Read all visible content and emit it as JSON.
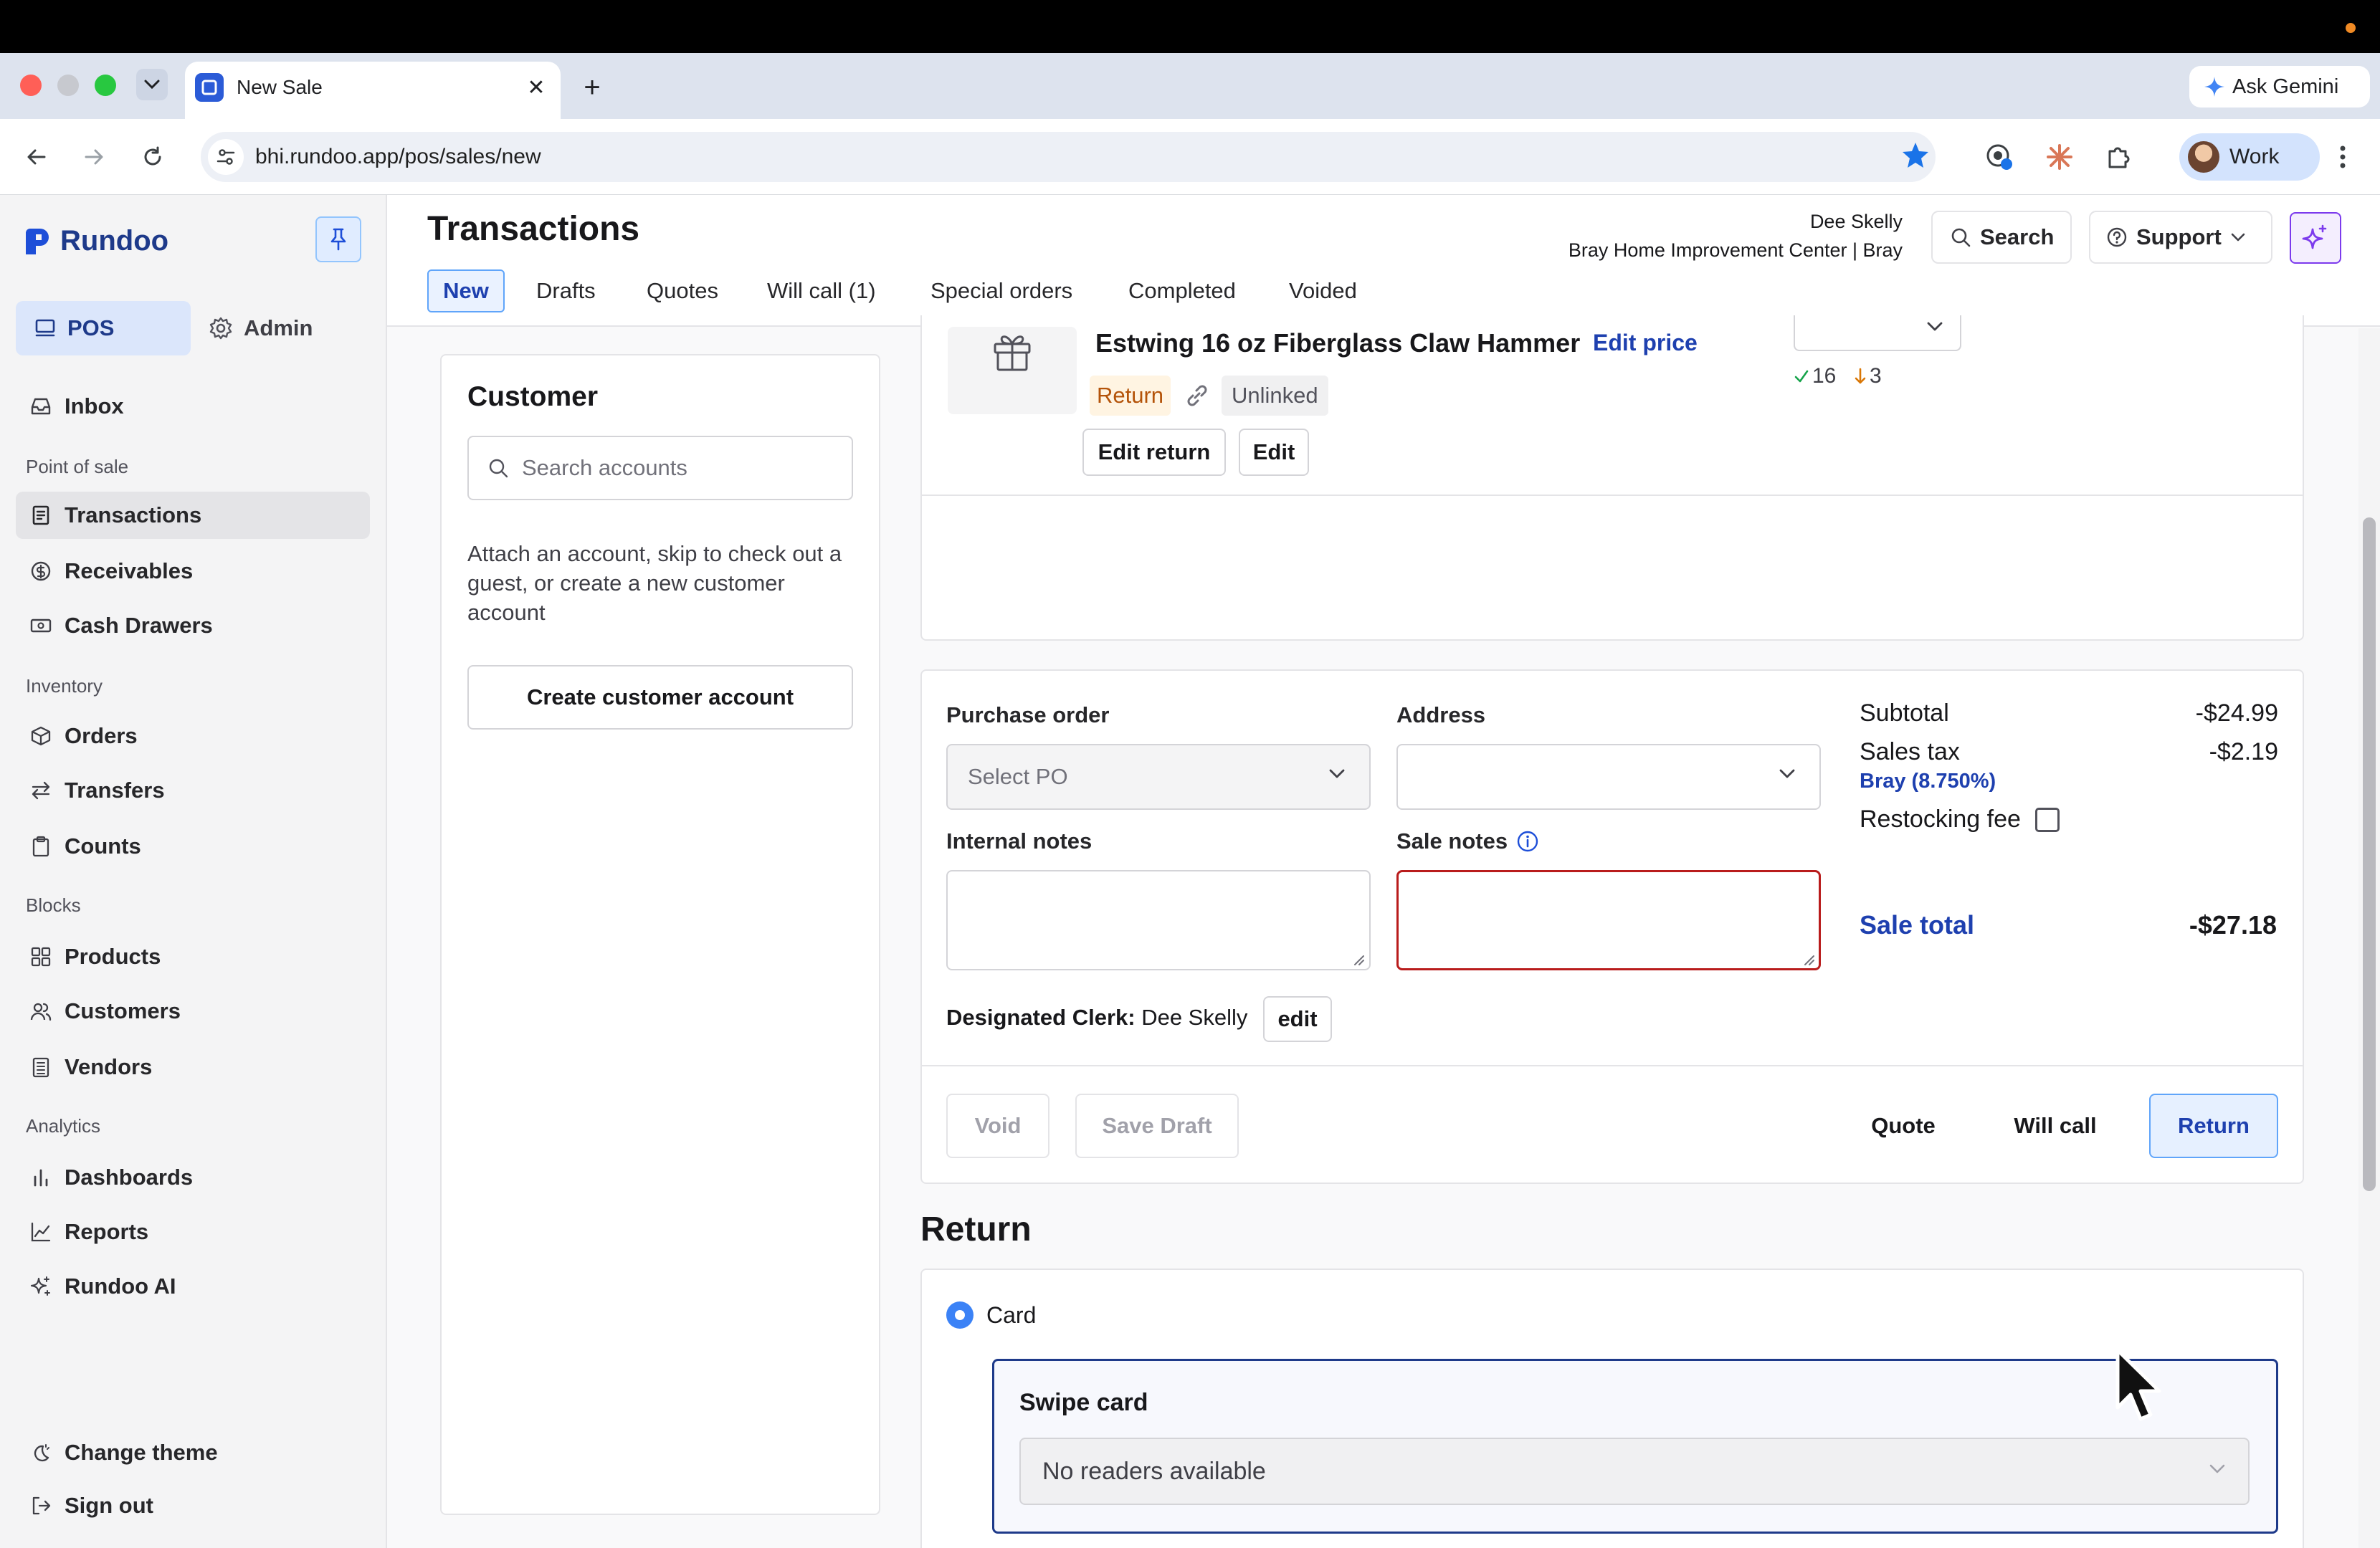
{
  "browser": {
    "tab_title": "New Sale",
    "url": "bhi.rundoo.app/pos/sales/new",
    "ask_gemini": "Ask Gemini",
    "profile_name": "Work"
  },
  "sidebar": {
    "logo": "Rundoo",
    "pos_label": "POS",
    "admin_label": "Admin",
    "inbox": "Inbox",
    "sections": {
      "point_of_sale": "Point of sale",
      "inventory": "Inventory",
      "blocks": "Blocks",
      "analytics": "Analytics"
    },
    "items": {
      "transactions": "Transactions",
      "receivables": "Receivables",
      "cash_drawers": "Cash Drawers",
      "orders": "Orders",
      "transfers": "Transfers",
      "counts": "Counts",
      "products": "Products",
      "customers": "Customers",
      "vendors": "Vendors",
      "dashboards": "Dashboards",
      "reports": "Reports",
      "rundoo_ai": "Rundoo AI"
    },
    "change_theme": "Change theme",
    "sign_out": "Sign out"
  },
  "header": {
    "title": "Transactions",
    "tabs": [
      "New",
      "Drafts",
      "Quotes",
      "Will call (1)",
      "Special orders",
      "Completed",
      "Voided"
    ],
    "user_name": "Dee Skelly",
    "store_name": "Bray Home Improvement Center | Bray",
    "search": "Search",
    "support": "Support"
  },
  "customer": {
    "title": "Customer",
    "search_placeholder": "Search accounts",
    "help_text": "Attach an account, skip to check out a guest, or create a new customer account",
    "create_button": "Create customer account"
  },
  "line_item": {
    "name": "Estwing 16 oz Fiberglass Claw Hammer",
    "edit_price": "Edit price",
    "return_badge": "Return",
    "unlinked_badge": "Unlinked",
    "stock_up": "16",
    "stock_down": "3",
    "edit_return": "Edit return",
    "edit": "Edit"
  },
  "order": {
    "purchase_order_label": "Purchase order",
    "purchase_order_placeholder": "Select PO",
    "address_label": "Address",
    "internal_notes_label": "Internal notes",
    "sale_notes_label": "Sale notes",
    "clerk_label": "Designated Clerk:",
    "clerk_name": "Dee Skelly",
    "clerk_edit": "edit",
    "subtotal_label": "Subtotal",
    "subtotal_value": "-$24.99",
    "sales_tax_label": "Sales tax",
    "sales_tax_value": "-$2.19",
    "tax_rate": "Bray (8.750%)",
    "restocking_fee_label": "Restocking fee",
    "restocking_fee_checked": false,
    "sale_total_label": "Sale total",
    "sale_total_value": "-$27.18",
    "buttons": {
      "void": "Void",
      "save_draft": "Save Draft",
      "quote": "Quote",
      "will_call": "Will call",
      "return": "Return"
    }
  },
  "payment": {
    "heading": "Return",
    "method_label": "Card",
    "method_selected": true,
    "swipe_title": "Swipe card",
    "reader_value": "No readers available"
  },
  "colors": {
    "accent_blue": "#1e40af",
    "error_red": "#b91c1c",
    "ai_purple": "#7c3aed"
  }
}
